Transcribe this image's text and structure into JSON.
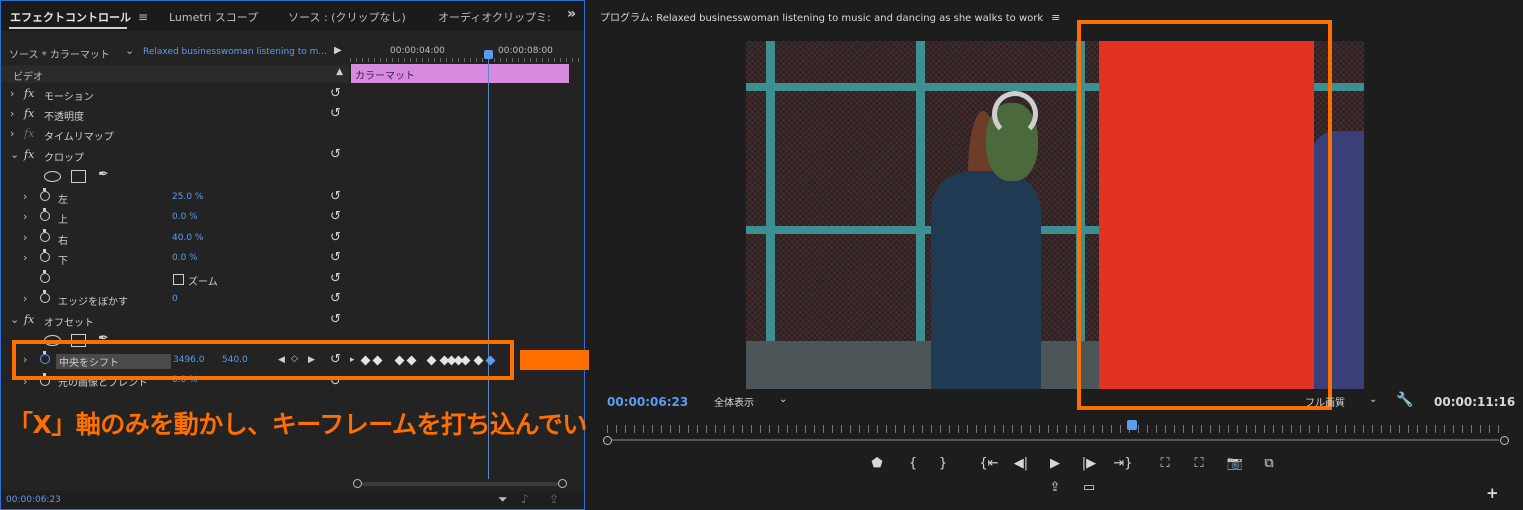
{
  "effect_controls": {
    "tabs": [
      {
        "label": "エフェクトコントロール"
      },
      {
        "label": "Lumetri スコープ"
      },
      {
        "label": "ソース : (クリップなし)"
      },
      {
        "label": "オーディオクリップミ:"
      }
    ],
    "source_label": "ソース * カラーマット",
    "clip_name": "Relaxed businesswoman listening to m...",
    "section_video": "ビデオ",
    "ruler_times": [
      "00:00:04:00",
      "00:00:08:00"
    ],
    "clip_bar_label": "カラーマット",
    "effects": {
      "motion": "モーション",
      "opacity": "不透明度",
      "time_remap": "タイムリマップ",
      "crop": "クロップ",
      "offset": "オフセット"
    },
    "crop_params": [
      {
        "name": "左",
        "value": "25.0 %"
      },
      {
        "name": "上",
        "value": "0.0 %"
      },
      {
        "name": "右",
        "value": "40.0 %"
      },
      {
        "name": "下",
        "value": "0.0 %"
      }
    ],
    "zoom_label": "ズーム",
    "edge_feather": {
      "name": "エッジをぼかす",
      "value": "0"
    },
    "shift_center": {
      "name": "中央をシフト",
      "x": "3496.0",
      "y": "540.0"
    },
    "blend_row": {
      "name": "元の画像とブレンド",
      "value": "0.0 %"
    },
    "footer_timecode": "00:00:06:23"
  },
  "annotation": {
    "caption": "「X」軸のみを動かし、キーフレームを打ち込んでいく",
    "accent_color": "#ff6f00"
  },
  "program_monitor": {
    "title": "プログラム: Relaxed businesswoman listening to music and dancing as she walks to work",
    "timecode_left": "00:00:06:23",
    "zoom_select": "全体表示",
    "quality_select": "フル画質",
    "timecode_right": "00:00:11:16"
  },
  "colors": {
    "accent_blue": "#5b9cf0",
    "clip_bar": "#d88ae0",
    "red_matte": "#e23322"
  }
}
